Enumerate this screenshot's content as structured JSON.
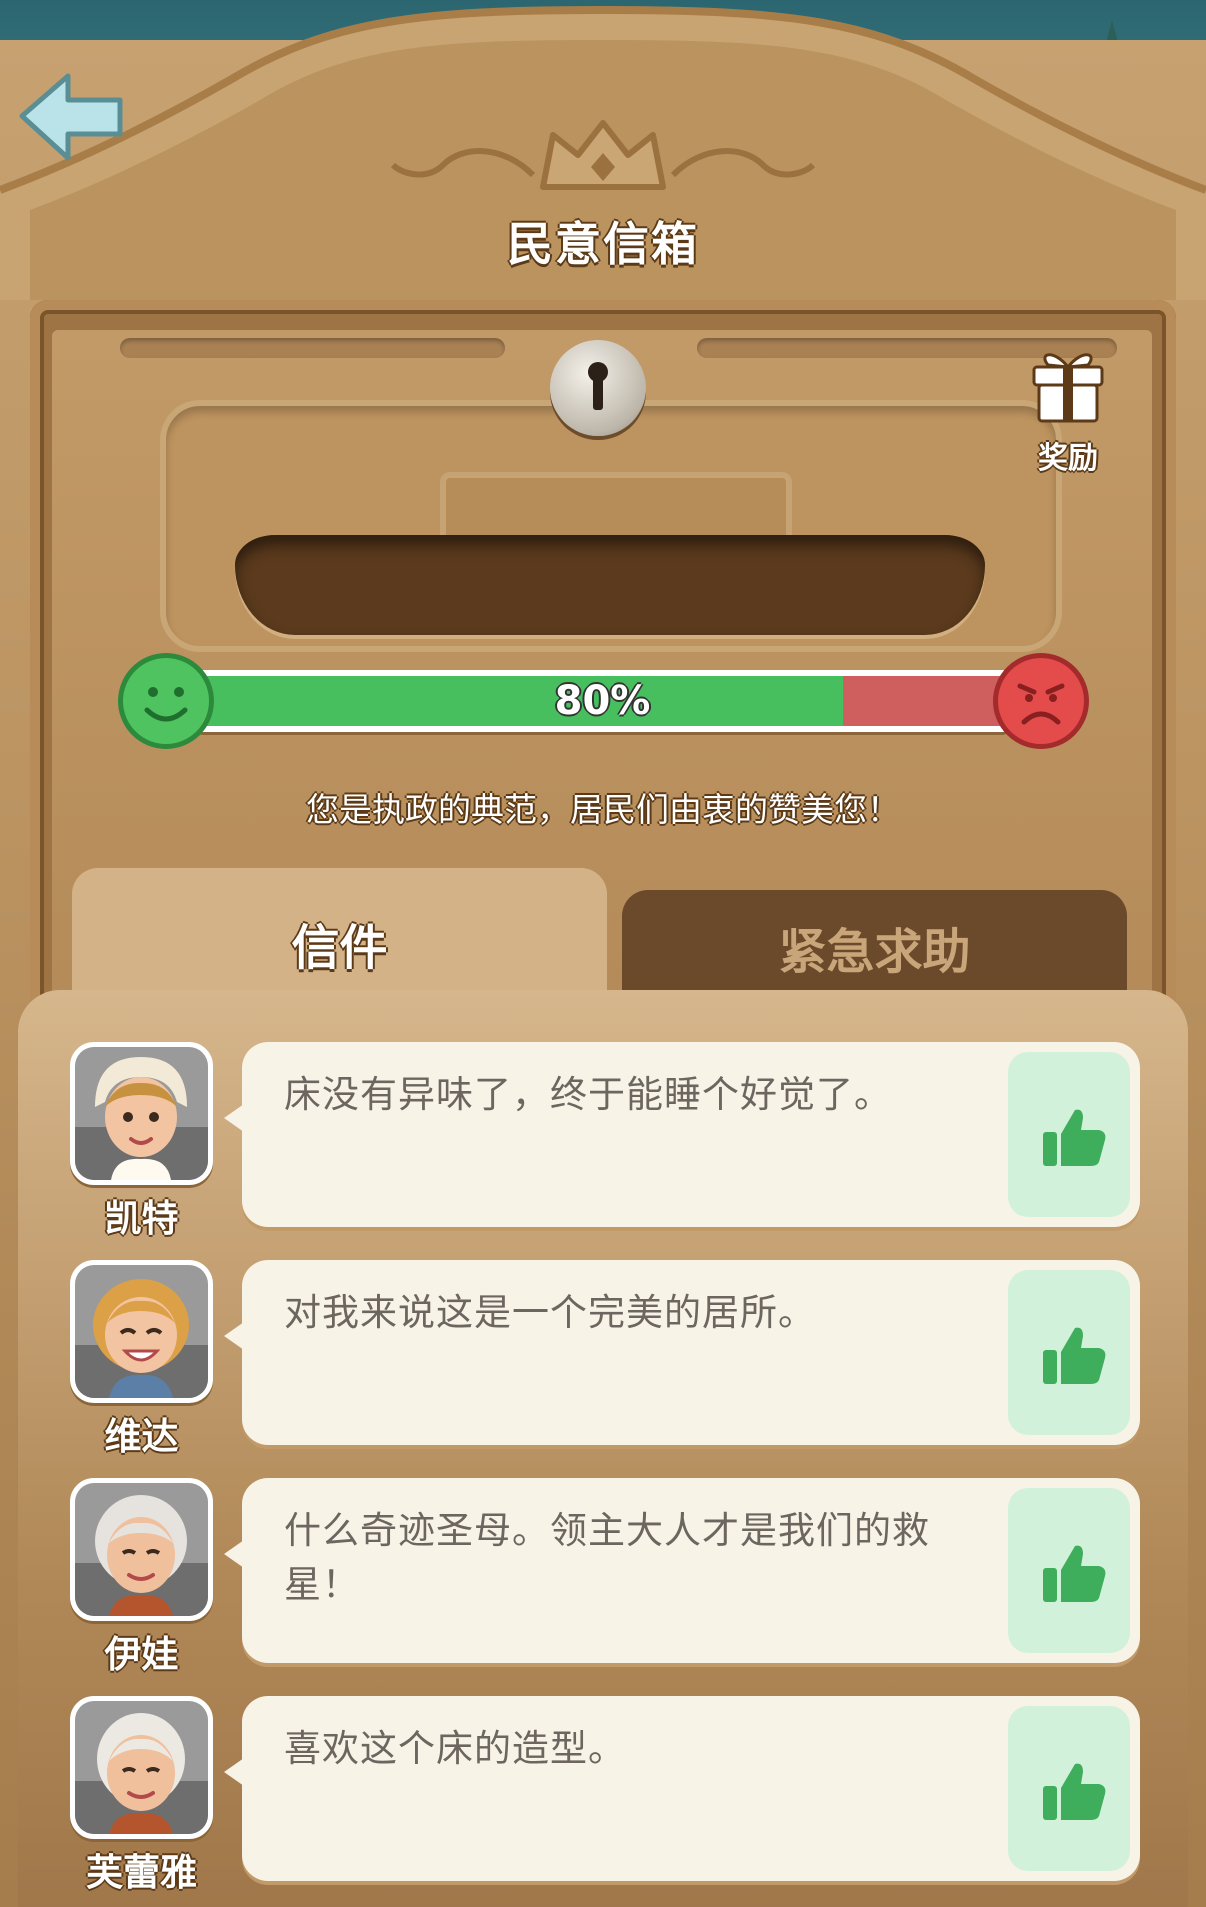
{
  "header": {
    "title": "民意信箱"
  },
  "mailbox": {
    "reward_label": "奖励",
    "satisfaction": {
      "value": 0.8,
      "display": "80%"
    },
    "status_message": "您是执政的典范，居民们由衷的赞美您！"
  },
  "tabs": [
    {
      "label": "信件",
      "active": true
    },
    {
      "label": "紧急求助",
      "active": false
    }
  ],
  "letters": [
    {
      "name": "凯特",
      "message": "床没有异味了，终于能睡个好觉了。"
    },
    {
      "name": "维达",
      "message": "对我来说这是一个完美的居所。"
    },
    {
      "name": "伊娃",
      "message": "什么奇迹圣母。领主大人才是我们的救星！"
    },
    {
      "name": "芙蕾雅",
      "message": "喜欢这个床的造型。"
    }
  ],
  "colors": {
    "bar_positive": "#47bf5e",
    "bar_negative": "#cf5f5f",
    "like_button_bg": "#d2f1da",
    "like_icon": "#3fae5c"
  }
}
